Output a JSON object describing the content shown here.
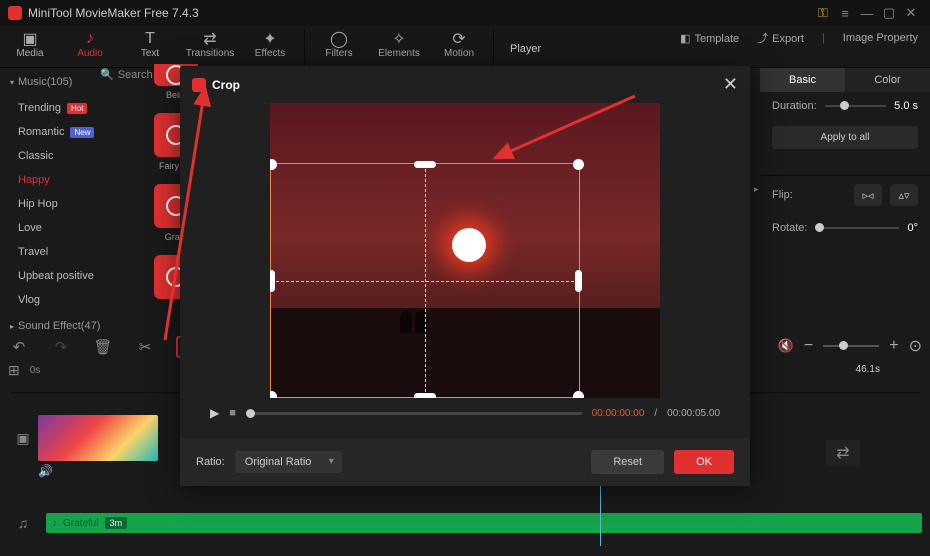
{
  "app": {
    "title": "MiniTool MovieMaker Free 7.4.3"
  },
  "toolbar": {
    "media": "Media",
    "audio": "Audio",
    "text": "Text",
    "transitions": "Transitions",
    "effects": "Effects",
    "filters": "Filters",
    "elements": "Elements",
    "motion": "Motion",
    "player": "Player",
    "template": "Template",
    "export": "Export",
    "image_property": "Image Property"
  },
  "sidebar": {
    "music_cat": "Music(105)",
    "search_placeholder": "Search audio",
    "items": [
      {
        "label": "Trending",
        "badge": "Hot"
      },
      {
        "label": "Romantic",
        "badge": "New"
      },
      {
        "label": "Classic"
      },
      {
        "label": "Happy",
        "selected": true
      },
      {
        "label": "Hip Hop"
      },
      {
        "label": "Love"
      },
      {
        "label": "Travel"
      },
      {
        "label": "Upbeat positive"
      },
      {
        "label": "Vlog"
      }
    ],
    "sound_cat": "Sound Effect(47)"
  },
  "thumbs": [
    {
      "label": ""
    },
    {
      "label": "Belie"
    },
    {
      "label": ""
    },
    {
      "label": "Fairy chi"
    },
    {
      "label": ""
    },
    {
      "label": "Grate"
    },
    {
      "label": ""
    }
  ],
  "rightpanel": {
    "tab_basic": "Basic",
    "tab_color": "Color",
    "duration_label": "Duration:",
    "duration_value": "5.0 s",
    "apply_all": "Apply to all",
    "flip_label": "Flip:",
    "rotate_label": "Rotate:",
    "rotate_value": "0°"
  },
  "timeline": {
    "start": "0s",
    "time": "46.1s"
  },
  "audio_clip": {
    "name": "Grateful",
    "duration_tag": "3m"
  },
  "modal": {
    "title": "Crop",
    "time_current": "00:00:00:00",
    "time_total": "00:00:05.00",
    "ratio_label": "Ratio:",
    "ratio_value": "Original Ratio",
    "reset": "Reset",
    "ok": "OK"
  }
}
